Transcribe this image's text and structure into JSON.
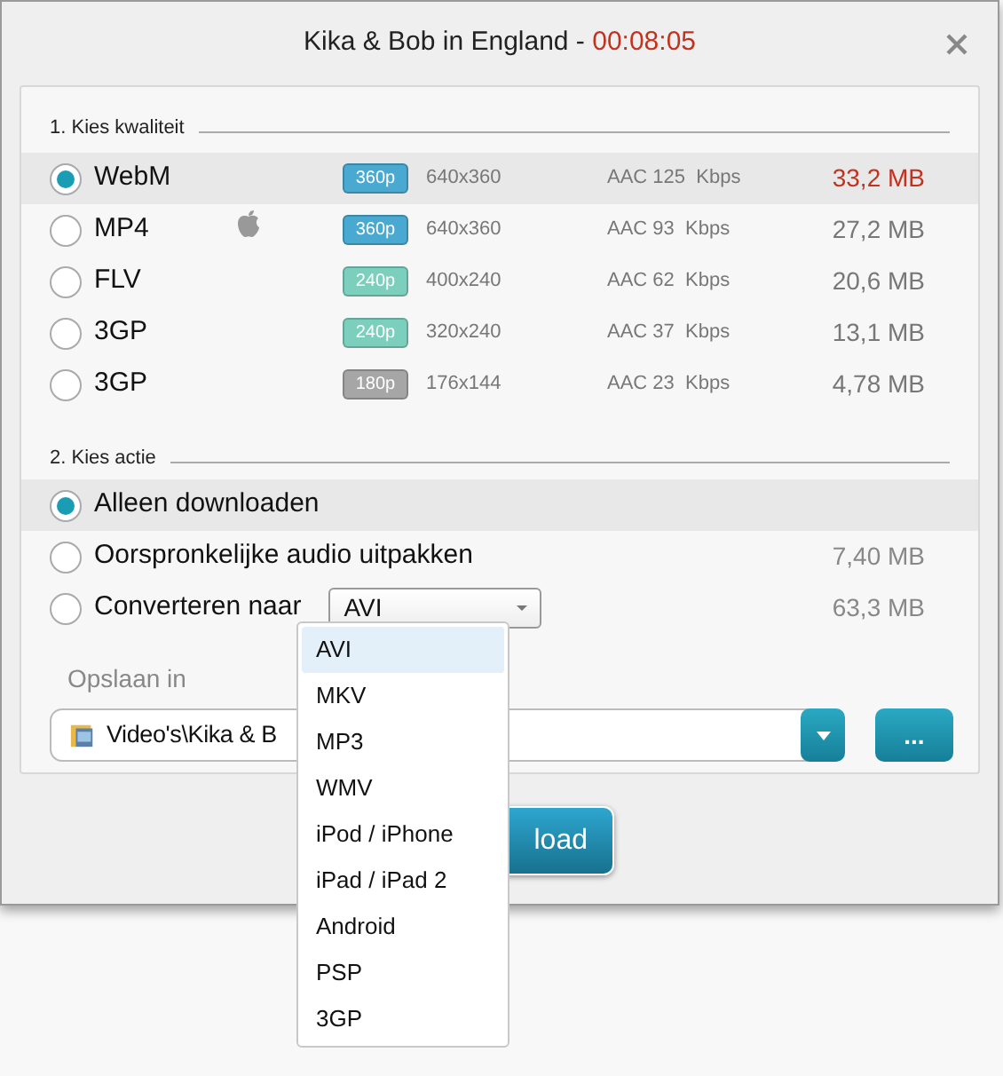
{
  "window": {
    "title": "Kika & Bob in England - ",
    "duration": "00:08:05"
  },
  "quality": {
    "heading": "1. Kies kwaliteit",
    "options": [
      {
        "format": "WebM",
        "device_icon": false,
        "badge": "360p",
        "color": "#4aa9d0",
        "resolution": "640x360",
        "audio": "AAC 125  Kbps",
        "size": "33,2 MB",
        "selected": true
      },
      {
        "format": "MP4",
        "device_icon": true,
        "badge": "360p",
        "color": "#4aa9d0",
        "resolution": "640x360",
        "audio": "AAC 93  Kbps",
        "size": "27,2 MB",
        "selected": false
      },
      {
        "format": "FLV",
        "device_icon": false,
        "badge": "240p",
        "color": "#7ccfbd",
        "resolution": "400x240",
        "audio": "AAC 62  Kbps",
        "size": "20,6 MB",
        "selected": false
      },
      {
        "format": "3GP",
        "device_icon": false,
        "badge": "240p",
        "color": "#7ccfbd",
        "resolution": "320x240",
        "audio": "AAC 37  Kbps",
        "size": "13,1 MB",
        "selected": false
      },
      {
        "format": "3GP",
        "device_icon": false,
        "badge": "180p",
        "color": "#a6a6a6",
        "resolution": "176x144",
        "audio": "AAC 23  Kbps",
        "size": "4,78 MB",
        "selected": false
      }
    ]
  },
  "action": {
    "heading": "2. Kies actie",
    "options": [
      {
        "kind": "plain",
        "label": "Alleen downloaden",
        "selected": true
      },
      {
        "kind": "plain",
        "label": "Oorspronkelijke audio uitpakken",
        "size": "7,40 MB",
        "selected": false
      },
      {
        "kind": "convert",
        "label": "Converteren naar",
        "value": "AVI",
        "size": "63,3 MB",
        "selected": false
      }
    ]
  },
  "save": {
    "label": "Opslaan in",
    "path": "Video's\\Kika & B",
    "browse": "..."
  },
  "download_button": "load",
  "format_menu": [
    {
      "label": "AVI",
      "selected": true
    },
    {
      "label": "MKV",
      "selected": false
    },
    {
      "label": "MP3",
      "selected": false
    },
    {
      "label": "WMV",
      "selected": false
    },
    {
      "label": "iPod / iPhone",
      "selected": false
    },
    {
      "label": "iPad / iPad 2",
      "selected": false
    },
    {
      "label": "Android",
      "selected": false
    },
    {
      "label": "PSP",
      "selected": false
    },
    {
      "label": "3GP",
      "selected": false
    }
  ]
}
